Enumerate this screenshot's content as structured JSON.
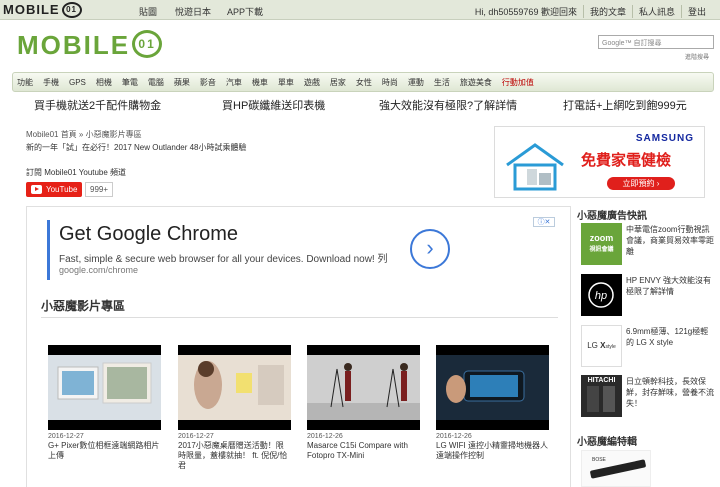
{
  "topbar": {
    "logo": "MOBILE",
    "logo_badge": "01",
    "links": [
      "貼圖",
      "悅遊日本",
      "APP下載"
    ],
    "user_greeting": "Hi, dh50559769 歡迎回來",
    "user_links": [
      "我的文章",
      "私人訊息",
      "登出"
    ]
  },
  "header": {
    "logo": "MOBILE",
    "logo_badge": "01",
    "search_placeholder": "Google™ 自訂搜尋",
    "advanced_search": "進階搜尋"
  },
  "categories": [
    "功能",
    "手機",
    "GPS",
    "相機",
    "筆電",
    "電腦",
    "蘋果",
    "影音",
    "汽車",
    "機車",
    "單車",
    "遊戲",
    "居家",
    "女性",
    "時尚",
    "運動",
    "生活",
    "旅遊美食",
    "行動加值"
  ],
  "promos": [
    "買手機就送2千配件購物金",
    "買HP碳纖維送印表機",
    "強大效能沒有極限?了解詳情",
    "打電話+上網吃到飽999元"
  ],
  "page": {
    "breadcrumb": "Mobile01 首頁 » 小惡魔影片專區",
    "subline": "新的一年「試」在必行！2017 New Outlander 48小時試乘體驗",
    "subscribe_label": "訂閱 Mobile01 Youtube 頻道",
    "youtube_label": "YouTube",
    "youtube_count": "999+"
  },
  "samsung_ad": {
    "brand": "SAMSUNG",
    "headline": "免費家電健檢",
    "cta": "立即預約 ›"
  },
  "google_ad": {
    "title": "Get Google Chrome",
    "desc": "Fast, simple & secure web browser for all your devices. Download now! 列",
    "url": "google.com/chrome",
    "arrow": "›",
    "adchoices": "ⓘ✕"
  },
  "section_title": "小惡魔影片專區",
  "videos": [
    {
      "date": "2016-12-27",
      "title": "G+ Pixer數位相框遠端網路相片上傳"
    },
    {
      "date": "2016-12-27",
      "title": "2017小惡魔桌曆贈送活動！限時限量，蓋樓就抽！ ft. 倪倪/恰君"
    },
    {
      "date": "2016-12-26",
      "title": "Masarce C15i Compare with Fotopro TX-Mini"
    },
    {
      "date": "2016-12-26",
      "title": "LG WIFI 遠控小精靈掃地機器人遠端操作控制"
    }
  ],
  "sidebar": {
    "ads_title": "小惡魔廣告快訊",
    "ads": [
      {
        "label": "zoom 視訊會議",
        "text": "中華電信zoom行動視訊會議，商業貿易效率零距離",
        "color": "#6aa53a"
      },
      {
        "label": "hp",
        "text": "HP ENVY 強大效能沒有極限了解詳情",
        "color": "#000000"
      },
      {
        "label": "LG X style",
        "text": "6.9mm極薄、121g極輕的 LG X style",
        "color": "#ffffff"
      },
      {
        "label": "HITACHI",
        "text": "日立頓幹科技，長效保鮮，封存鮮味，營養不流失！",
        "color": "#2a2a2a"
      }
    ],
    "special_title": "小惡魔編特輯"
  }
}
